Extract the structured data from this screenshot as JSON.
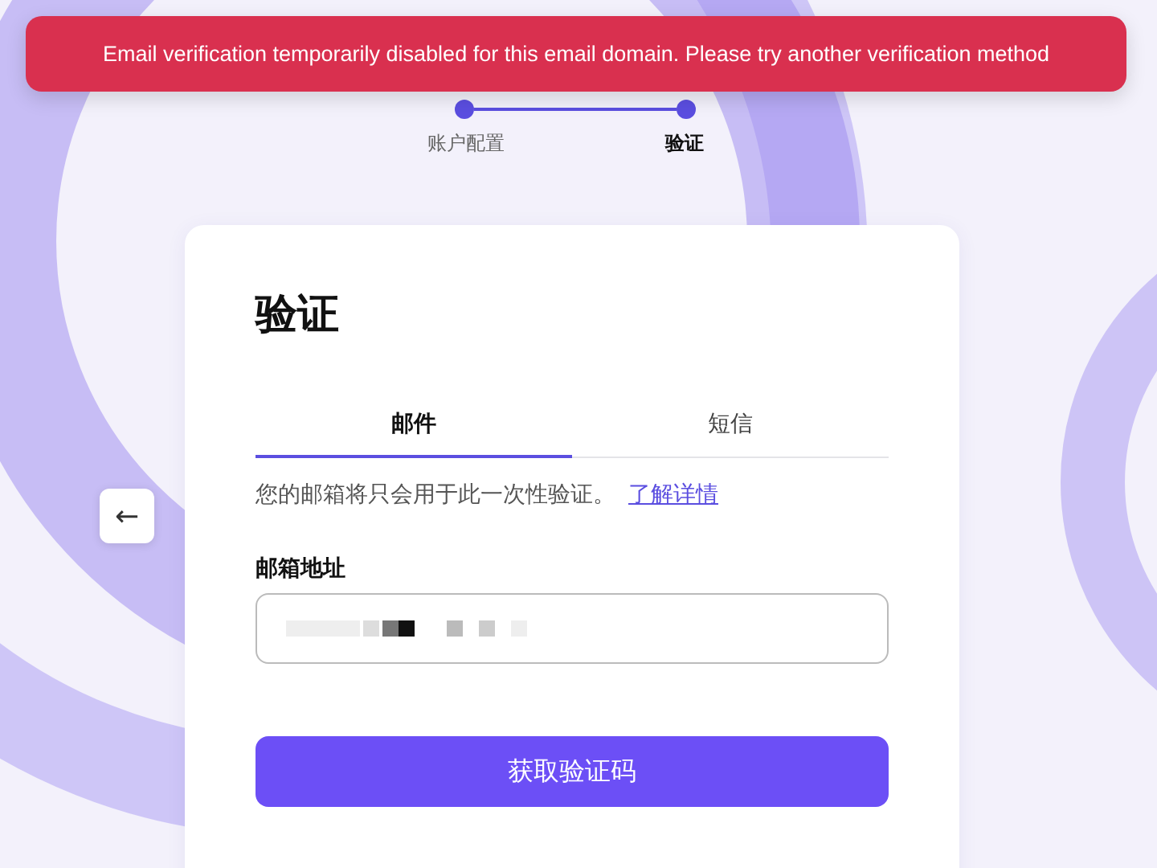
{
  "alert": {
    "message": "Email verification temporarily disabled for this email domain. Please try another verification method"
  },
  "stepper": {
    "steps": [
      {
        "label": "账户配置",
        "selected": false
      },
      {
        "label": "验证",
        "selected": true
      }
    ]
  },
  "back_button": {
    "icon": "←"
  },
  "card": {
    "title": "验证",
    "tabs": [
      {
        "label": "邮件",
        "selected": true
      },
      {
        "label": "短信",
        "selected": false
      }
    ],
    "notice": "您的邮箱将只会用于此一次性验证。",
    "notice_link": "了解详情",
    "email_field": {
      "label": "邮箱地址"
    },
    "submit_button": "获取验证码"
  }
}
